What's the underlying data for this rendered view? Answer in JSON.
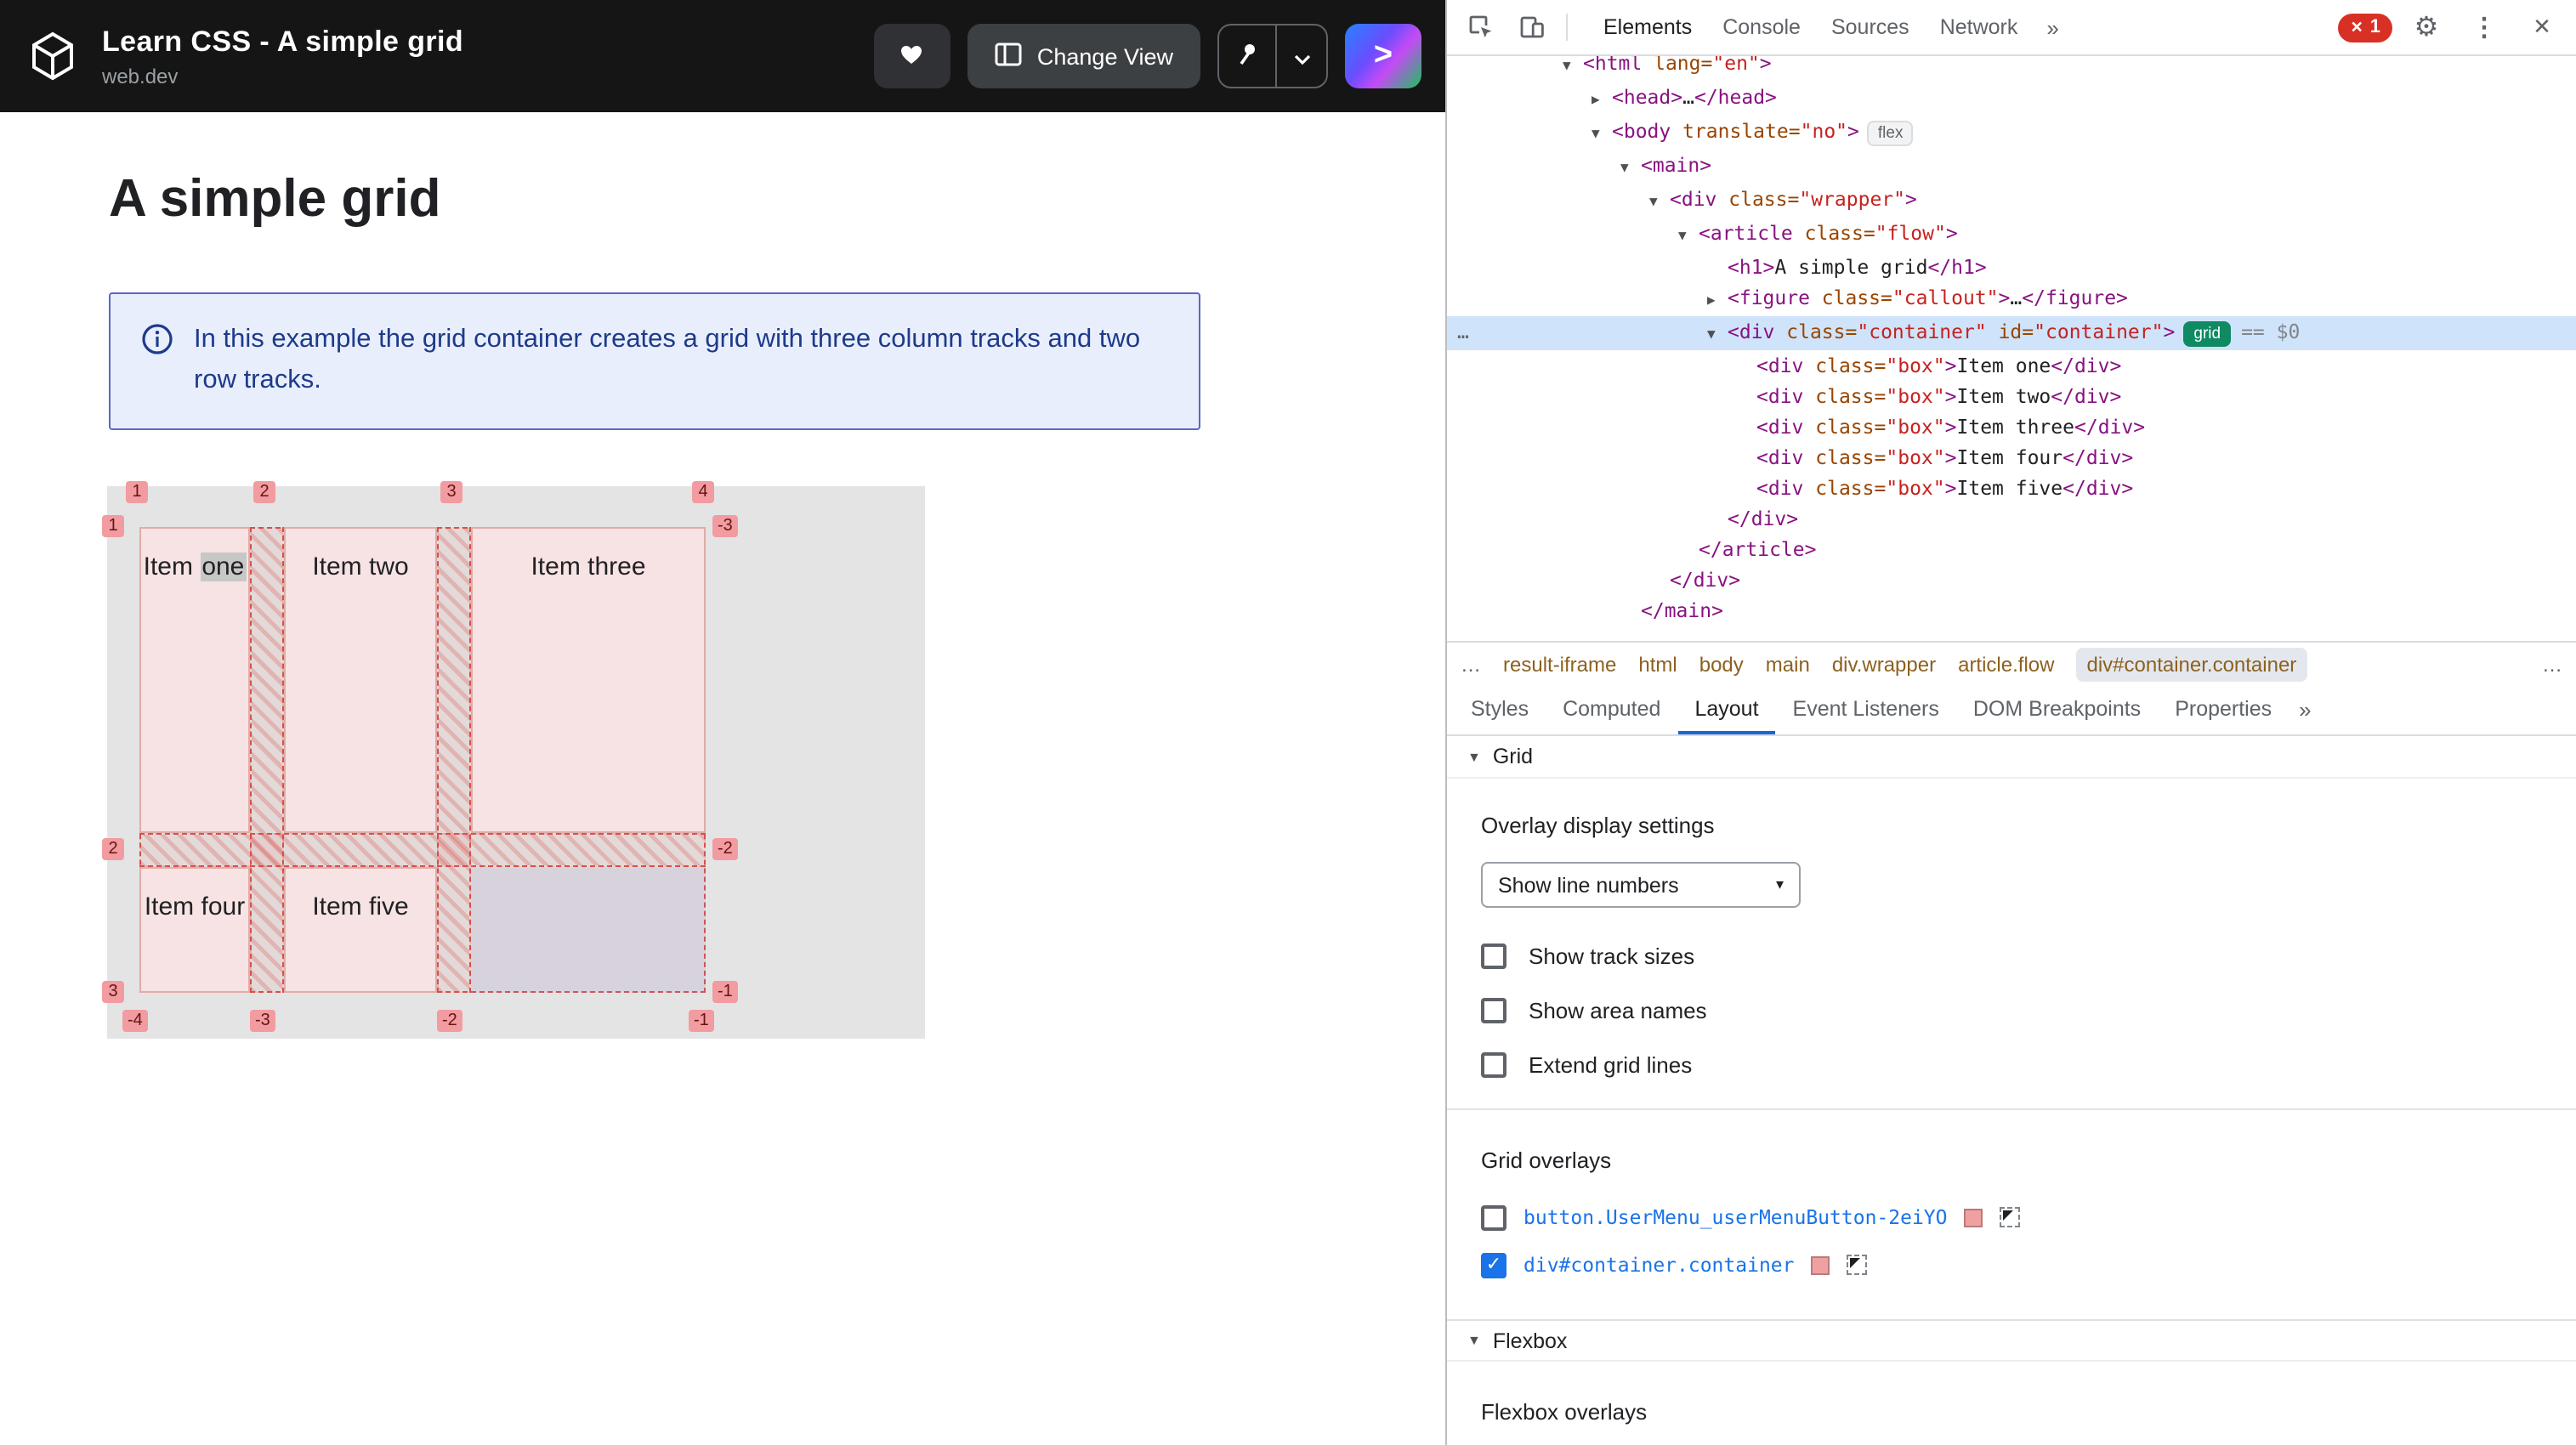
{
  "colors": {
    "header_bg": "#151515",
    "accent_blue": "#1a73e8",
    "selection_blue": "#cfe3fb",
    "grid_badge_green": "#0f8a63",
    "grid_overlay_red": "#d7504a",
    "overlay_swatch_pink": "#efa1a1",
    "callout_bg": "#e8eefc",
    "callout_border": "#5968c4",
    "error_red": "#d93025"
  },
  "page": {
    "header": {
      "title": "Learn CSS - A simple grid",
      "site": "web.dev",
      "change_view_label": "Change View"
    },
    "main": {
      "heading": "A simple grid",
      "callout": "In this example the grid container creates a grid with three column tracks and two row tracks."
    },
    "grid_demo": {
      "items": [
        {
          "label": "Item one",
          "highlight": "one"
        },
        {
          "label": "Item two"
        },
        {
          "label": "Item three"
        },
        {
          "label": "Item four"
        },
        {
          "label": "Item five"
        }
      ],
      "column_lines": [
        "1",
        "2",
        "3",
        "4"
      ],
      "column_lines_negative": [
        "-4",
        "-3",
        "-2",
        "-1"
      ],
      "row_lines": [
        "1",
        "2",
        "3"
      ],
      "row_lines_negative": [
        "-3",
        "-2",
        "-1"
      ]
    }
  },
  "devtools": {
    "tabs": [
      "Elements",
      "Console",
      "Sources",
      "Network"
    ],
    "active_tab": "Elements",
    "more_glyph": "»",
    "error_icon": "✕",
    "error_count": "1",
    "tree": [
      {
        "indent": 0,
        "arrow": "open",
        "clipped": true,
        "tokens": [
          [
            "tag",
            "<html"
          ],
          [
            "attr",
            " lang"
          ],
          [
            "eq",
            "="
          ],
          [
            "val",
            "\"en\""
          ],
          [
            "tag",
            ">"
          ]
        ]
      },
      {
        "indent": 1,
        "arrow": "closed",
        "tokens": [
          [
            "tag",
            "<head>"
          ],
          [
            "text",
            "…"
          ],
          [
            "tag",
            "</head>"
          ]
        ]
      },
      {
        "indent": 1,
        "arrow": "open",
        "badge": "flex",
        "tokens": [
          [
            "tag",
            "<body"
          ],
          [
            "attr",
            " translate"
          ],
          [
            "eq",
            "="
          ],
          [
            "val",
            "\"no\""
          ],
          [
            "tag",
            ">"
          ]
        ]
      },
      {
        "indent": 2,
        "arrow": "open",
        "tokens": [
          [
            "tag",
            "<main>"
          ]
        ]
      },
      {
        "indent": 3,
        "arrow": "open",
        "tokens": [
          [
            "tag",
            "<div"
          ],
          [
            "attr",
            " class"
          ],
          [
            "eq",
            "="
          ],
          [
            "val",
            "\"wrapper\""
          ],
          [
            "tag",
            ">"
          ]
        ]
      },
      {
        "indent": 4,
        "arrow": "open",
        "tokens": [
          [
            "tag",
            "<article"
          ],
          [
            "attr",
            " class"
          ],
          [
            "eq",
            "="
          ],
          [
            "val",
            "\"flow\""
          ],
          [
            "tag",
            ">"
          ]
        ]
      },
      {
        "indent": 5,
        "arrow": "none",
        "tokens": [
          [
            "tag",
            "<h1>"
          ],
          [
            "text",
            "A simple grid"
          ],
          [
            "tag",
            "</h1>"
          ]
        ]
      },
      {
        "indent": 5,
        "arrow": "closed",
        "tokens": [
          [
            "tag",
            "<figure"
          ],
          [
            "attr",
            " class"
          ],
          [
            "eq",
            "="
          ],
          [
            "val",
            "\"callout\""
          ],
          [
            "tag",
            ">"
          ],
          [
            "text",
            "…"
          ],
          [
            "tag",
            "</figure>"
          ]
        ]
      },
      {
        "indent": 5,
        "arrow": "open",
        "selected": true,
        "badge": "grid",
        "suffix": "== $0",
        "tokens": [
          [
            "tag",
            "<div"
          ],
          [
            "attr",
            " class"
          ],
          [
            "eq",
            "="
          ],
          [
            "val",
            "\"container\""
          ],
          [
            "attr",
            " id"
          ],
          [
            "eq",
            "="
          ],
          [
            "val",
            "\"container\""
          ],
          [
            "tag",
            ">"
          ]
        ]
      },
      {
        "indent": 6,
        "arrow": "none",
        "tokens": [
          [
            "tag",
            "<div"
          ],
          [
            "attr",
            " class"
          ],
          [
            "eq",
            "="
          ],
          [
            "val",
            "\"box\""
          ],
          [
            "tag",
            ">"
          ],
          [
            "text",
            "Item one"
          ],
          [
            "tag",
            "</div>"
          ]
        ]
      },
      {
        "indent": 6,
        "arrow": "none",
        "tokens": [
          [
            "tag",
            "<div"
          ],
          [
            "attr",
            " class"
          ],
          [
            "eq",
            "="
          ],
          [
            "val",
            "\"box\""
          ],
          [
            "tag",
            ">"
          ],
          [
            "text",
            "Item two"
          ],
          [
            "tag",
            "</div>"
          ]
        ]
      },
      {
        "indent": 6,
        "arrow": "none",
        "tokens": [
          [
            "tag",
            "<div"
          ],
          [
            "attr",
            " class"
          ],
          [
            "eq",
            "="
          ],
          [
            "val",
            "\"box\""
          ],
          [
            "tag",
            ">"
          ],
          [
            "text",
            "Item three"
          ],
          [
            "tag",
            "</div>"
          ]
        ]
      },
      {
        "indent": 6,
        "arrow": "none",
        "tokens": [
          [
            "tag",
            "<div"
          ],
          [
            "attr",
            " class"
          ],
          [
            "eq",
            "="
          ],
          [
            "val",
            "\"box\""
          ],
          [
            "tag",
            ">"
          ],
          [
            "text",
            "Item four"
          ],
          [
            "tag",
            "</div>"
          ]
        ]
      },
      {
        "indent": 6,
        "arrow": "none",
        "tokens": [
          [
            "tag",
            "<div"
          ],
          [
            "attr",
            " class"
          ],
          [
            "eq",
            "="
          ],
          [
            "val",
            "\"box\""
          ],
          [
            "tag",
            ">"
          ],
          [
            "text",
            "Item five"
          ],
          [
            "tag",
            "</div>"
          ]
        ]
      },
      {
        "indent": 5,
        "arrow": "none",
        "tokens": [
          [
            "tag",
            "</div>"
          ]
        ]
      },
      {
        "indent": 4,
        "arrow": "none",
        "tokens": [
          [
            "tag",
            "</article>"
          ]
        ]
      },
      {
        "indent": 3,
        "arrow": "none",
        "tokens": [
          [
            "tag",
            "</div>"
          ]
        ]
      },
      {
        "indent": 2,
        "arrow": "none",
        "tokens": [
          [
            "tag",
            "</main>"
          ]
        ]
      }
    ],
    "breadcrumbs": [
      {
        "label": "…",
        "overflow": true
      },
      {
        "label": "result-iframe"
      },
      {
        "label": "html"
      },
      {
        "label": "body"
      },
      {
        "label": "main"
      },
      {
        "label": "div.wrapper"
      },
      {
        "label": "article.flow"
      },
      {
        "label": "div#container.container",
        "selected": true
      }
    ],
    "crumbs_overflow": "…",
    "panel_tabs": [
      "Styles",
      "Computed",
      "Layout",
      "Event Listeners",
      "DOM Breakpoints",
      "Properties"
    ],
    "active_panel_tab": "Layout",
    "layout": {
      "section_arrow": "▼",
      "grid_section": "Grid",
      "overlay_settings_title": "Overlay display settings",
      "dropdown_value": "Show line numbers",
      "dropdown_arrow": "▾",
      "checkboxes": [
        "Show track sizes",
        "Show area names",
        "Extend grid lines"
      ],
      "check_glyph": "✓",
      "grid_overlays_title": "Grid overlays",
      "overlays": [
        {
          "label": "button.UserMenu_userMenuButton-2eiYO",
          "checked": false
        },
        {
          "label": "div#container.container",
          "checked": true
        }
      ],
      "flexbox_section": "Flexbox",
      "flexbox_overlays_title": "Flexbox overlays"
    }
  }
}
